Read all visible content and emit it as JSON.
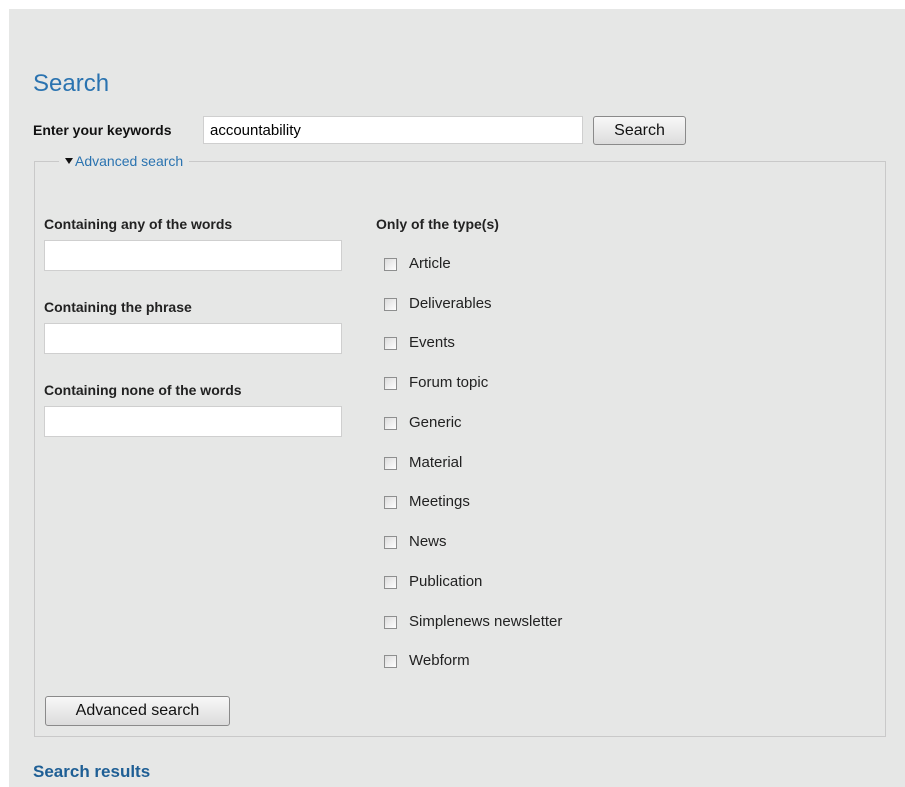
{
  "page": {
    "title": "Search"
  },
  "keywords": {
    "label": "Enter your keywords",
    "value": "accountability",
    "button_label": "Search"
  },
  "advanced": {
    "legend": "Advanced search",
    "any_words_label": "Containing any of the words",
    "phrase_label": "Containing the phrase",
    "none_words_label": "Containing none of the words",
    "types_label": "Only of the type(s)",
    "types": [
      "Article",
      "Deliverables",
      "Events",
      "Forum topic",
      "Generic",
      "Material",
      "Meetings",
      "News",
      "Publication",
      "Simplenews newsletter",
      "Webform"
    ],
    "button_label": "Advanced search"
  },
  "results": {
    "heading": "Search results"
  },
  "colors": {
    "link": "#2a73b0",
    "heading": "#1f5f95",
    "panel_bg": "#e6e7e6"
  }
}
